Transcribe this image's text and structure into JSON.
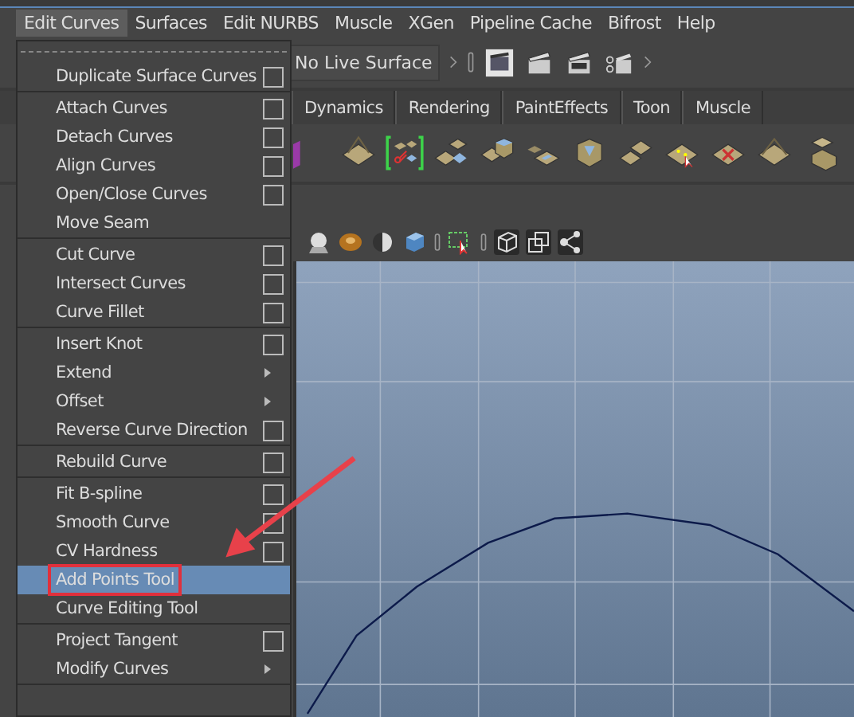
{
  "menubar": [
    {
      "label": "Edit Curves",
      "selected": true
    },
    {
      "label": "Surfaces",
      "selected": false
    },
    {
      "label": "Edit NURBS",
      "selected": false
    },
    {
      "label": "Muscle",
      "selected": false
    },
    {
      "label": "XGen",
      "selected": false
    },
    {
      "label": "Pipeline Cache",
      "selected": false
    },
    {
      "label": "Bifrost",
      "selected": false
    },
    {
      "label": "Help",
      "selected": false
    }
  ],
  "status_line": {
    "live_surface": "No Live Surface"
  },
  "shelf_tabs": [
    {
      "label": "Dynamics",
      "selected": false
    },
    {
      "label": "Rendering",
      "selected": false
    },
    {
      "label": "PaintEffects",
      "selected": false
    },
    {
      "label": "Toon",
      "selected": false
    },
    {
      "label": "Muscle",
      "selected": false
    }
  ],
  "menu": {
    "groups": [
      [
        {
          "label": "Duplicate Surface Curves",
          "kind": "option",
          "selected": false,
          "annotated": false
        }
      ],
      [
        {
          "label": "Attach Curves",
          "kind": "option",
          "selected": false,
          "annotated": false
        },
        {
          "label": "Detach Curves",
          "kind": "option",
          "selected": false,
          "annotated": false
        },
        {
          "label": "Align Curves",
          "kind": "option",
          "selected": false,
          "annotated": false
        },
        {
          "label": "Open/Close Curves",
          "kind": "option",
          "selected": false,
          "annotated": false
        },
        {
          "label": "Move Seam",
          "kind": "plain",
          "selected": false,
          "annotated": false
        }
      ],
      [
        {
          "label": "Cut Curve",
          "kind": "option",
          "selected": false,
          "annotated": false
        },
        {
          "label": "Intersect Curves",
          "kind": "option",
          "selected": false,
          "annotated": false
        },
        {
          "label": "Curve Fillet",
          "kind": "option",
          "selected": false,
          "annotated": false
        }
      ],
      [
        {
          "label": "Insert Knot",
          "kind": "option",
          "selected": false,
          "annotated": false
        },
        {
          "label": "Extend",
          "kind": "submenu",
          "selected": false,
          "annotated": false
        },
        {
          "label": "Offset",
          "kind": "submenu",
          "selected": false,
          "annotated": false
        },
        {
          "label": "Reverse Curve Direction",
          "kind": "option",
          "selected": false,
          "annotated": false
        }
      ],
      [
        {
          "label": "Rebuild Curve",
          "kind": "option",
          "selected": false,
          "annotated": false
        }
      ],
      [
        {
          "label": "Fit B-spline",
          "kind": "option",
          "selected": false,
          "annotated": false
        },
        {
          "label": "Smooth Curve",
          "kind": "option",
          "selected": false,
          "annotated": false
        },
        {
          "label": "CV Hardness",
          "kind": "option",
          "selected": false,
          "annotated": false
        },
        {
          "label": "Add Points Tool",
          "kind": "plain",
          "selected": true,
          "annotated": true
        },
        {
          "label": "Curve Editing Tool",
          "kind": "plain",
          "selected": false,
          "annotated": false
        }
      ],
      [
        {
          "label": "Project Tangent",
          "kind": "option",
          "selected": false,
          "annotated": false
        },
        {
          "label": "Modify Curves",
          "kind": "submenu",
          "selected": false,
          "annotated": false
        }
      ]
    ]
  }
}
